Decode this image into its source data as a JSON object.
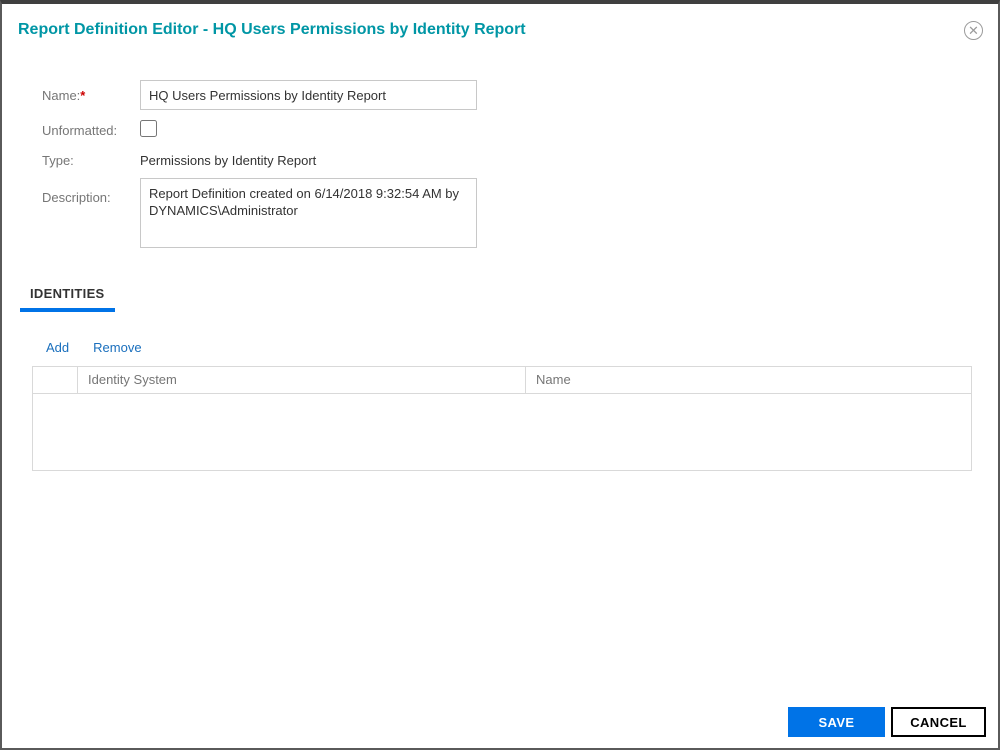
{
  "window": {
    "title": "Report Definition Editor - HQ Users Permissions by Identity Report",
    "close_glyph": "✕"
  },
  "form": {
    "name_label": "Name:",
    "required_marker": "*",
    "name_value": "HQ Users Permissions by Identity Report",
    "unformatted_label": "Unformatted:",
    "unformatted_checked": false,
    "type_label": "Type:",
    "type_value": "Permissions by Identity Report",
    "description_label": "Description:",
    "description_value": "Report Definition created on 6/14/2018 9:32:54 AM by DYNAMICS\\Administrator"
  },
  "tabs": [
    {
      "label": "IDENTITIES",
      "active": true
    }
  ],
  "toolbar": {
    "add_label": "Add",
    "remove_label": "Remove"
  },
  "table": {
    "columns": [
      "",
      "Identity System",
      "Name"
    ],
    "rows": []
  },
  "footer": {
    "save_label": "SAVE",
    "cancel_label": "CANCEL"
  },
  "colors": {
    "title_teal": "#0096a5",
    "accent_blue": "#0073e7",
    "link_blue": "#1a6fbd",
    "label_gray": "#767676",
    "border_gray": "#d9d9d9"
  }
}
